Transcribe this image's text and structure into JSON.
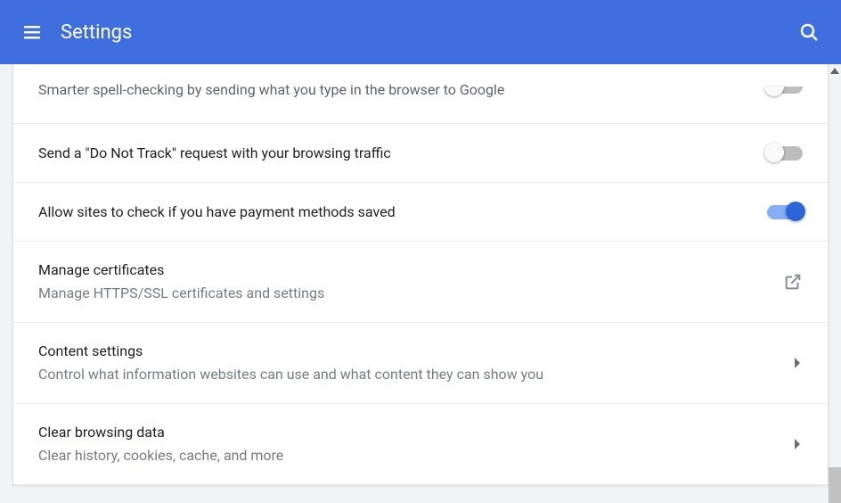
{
  "header": {
    "title": "Settings"
  },
  "rows": {
    "spellcheck": {
      "subtitle": "Smarter spell-checking by sending what you type in the browser to Google",
      "toggle": false
    },
    "dnt": {
      "title": "Send a \"Do Not Track\" request with your browsing traffic",
      "toggle": false
    },
    "payment": {
      "title": "Allow sites to check if you have payment methods saved",
      "toggle": true
    },
    "certs": {
      "title": "Manage certificates",
      "subtitle": "Manage HTTPS/SSL certificates and settings"
    },
    "content": {
      "title": "Content settings",
      "subtitle": "Control what information websites can use and what content they can show you"
    },
    "clear": {
      "title": "Clear browsing data",
      "subtitle": "Clear history, cookies, cache, and more"
    }
  }
}
